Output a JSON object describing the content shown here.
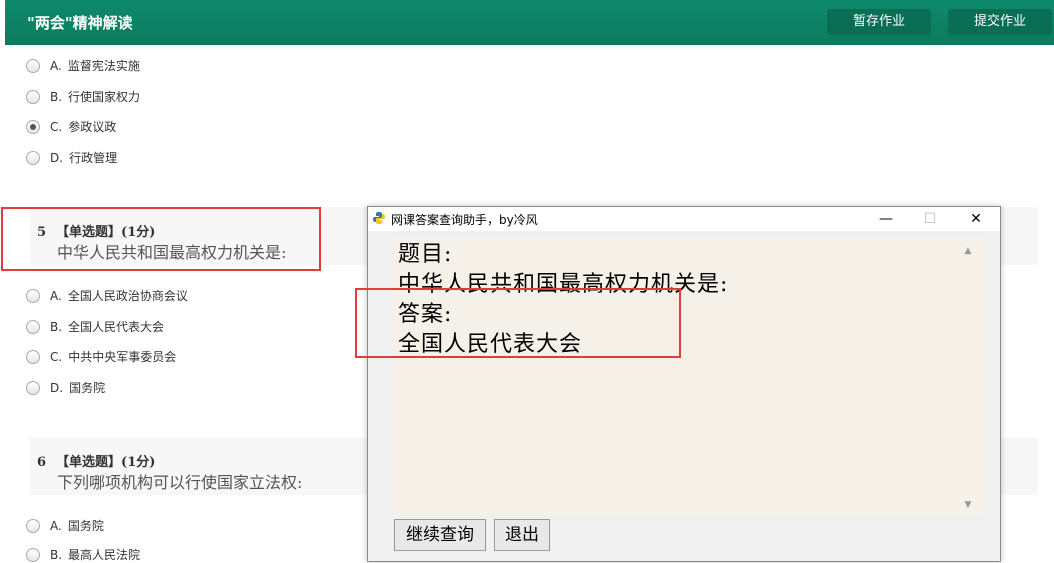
{
  "header": {
    "title": "\"两会\"精神解读",
    "save_label": "暂存作业",
    "submit_label": "提交作业"
  },
  "q4_options": [
    {
      "letter": "A.",
      "text": "监督宪法实施",
      "checked": false
    },
    {
      "letter": "B.",
      "text": "行使国家权力",
      "checked": false
    },
    {
      "letter": "C.",
      "text": "参政议政",
      "checked": true
    },
    {
      "letter": "D.",
      "text": "行政管理",
      "checked": false
    }
  ],
  "q5": {
    "number": "5",
    "type": "【单选题】(1分)",
    "text": "中华人民共和国最高权力机关是:",
    "options": [
      {
        "letter": "A.",
        "text": "全国人民政治协商会议"
      },
      {
        "letter": "B.",
        "text": "全国人民代表大会"
      },
      {
        "letter": "C.",
        "text": "中共中央军事委员会"
      },
      {
        "letter": "D.",
        "text": "国务院"
      }
    ]
  },
  "q6": {
    "number": "6",
    "type": "【单选题】(1分)",
    "text": "下列哪项机构可以行使国家立法权:",
    "options": [
      {
        "letter": "A.",
        "text": "国务院"
      },
      {
        "letter": "B.",
        "text": "最高人民法院"
      }
    ]
  },
  "popup": {
    "title": "网课答案查询助手，by冷风",
    "min": "—",
    "max": "☐",
    "close": "✕",
    "line1": "题目:",
    "line2": "中华人民共和国最高权力机关是:",
    "line3": "答案:",
    "line4": "全国人民代表大会",
    "continue_label": "继续查询",
    "exit_label": "退出"
  }
}
